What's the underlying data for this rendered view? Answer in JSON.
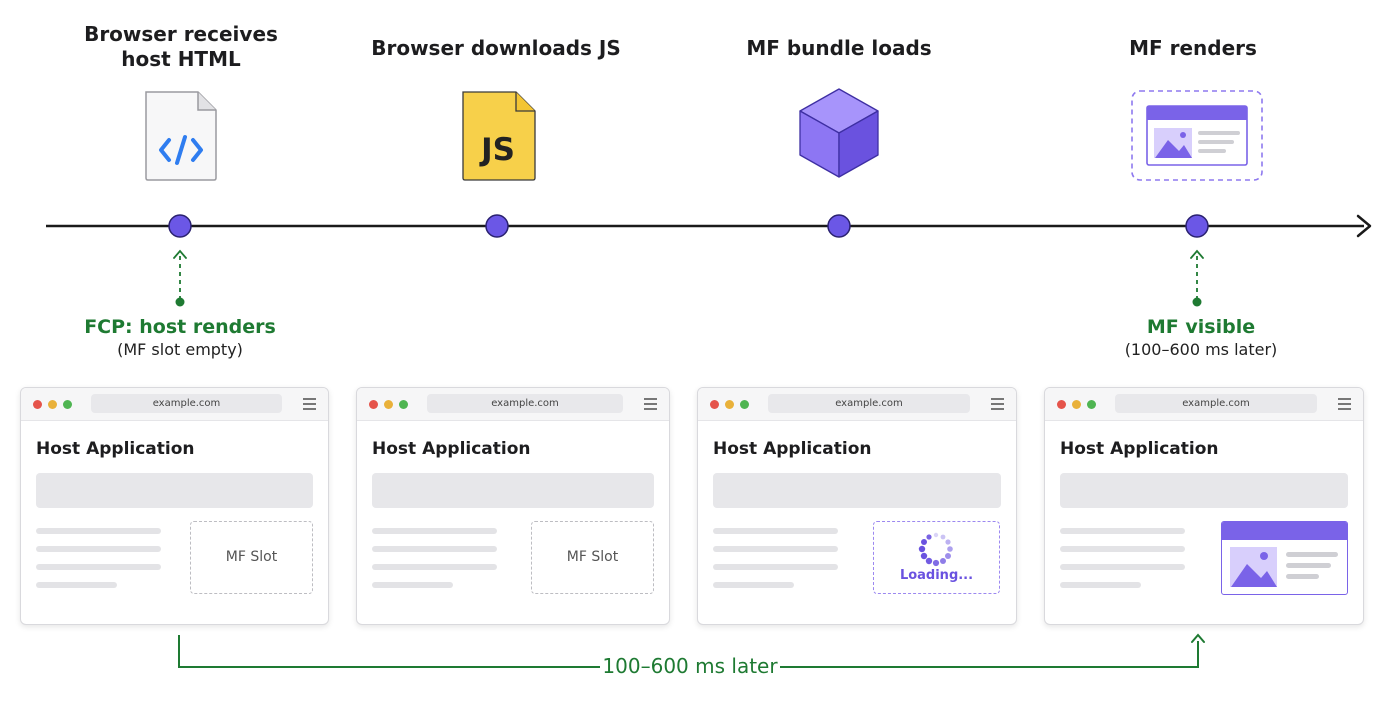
{
  "stages": [
    {
      "title": "Browser receives\nhost HTML",
      "icon": "html-file-icon"
    },
    {
      "title": "Browser downloads JS",
      "icon": "js-file-icon",
      "icon_text": "JS"
    },
    {
      "title": "MF bundle loads",
      "icon": "cube-icon"
    },
    {
      "title": "MF renders",
      "icon": "widget-icon"
    }
  ],
  "notes": {
    "fcp": {
      "title": "FCP: host renders",
      "subtitle": "(MF slot empty)"
    },
    "mf_visible": {
      "title": "MF visible",
      "subtitle": "(100–600 ms later)"
    }
  },
  "browsers": [
    {
      "url": "example.com",
      "app_title": "Host Application",
      "slot_label": "MF Slot"
    },
    {
      "url": "example.com",
      "app_title": "Host Application",
      "slot_label": "MF Slot"
    },
    {
      "url": "example.com",
      "app_title": "Host Application",
      "loading_label": "Loading..."
    },
    {
      "url": "example.com",
      "app_title": "Host Application"
    }
  ],
  "range_label": "100–600 ms later",
  "colors": {
    "accent_purple": "#6b57e6",
    "green": "#1e7a32",
    "js_yellow": "#f7d04a",
    "axis": "#1a1a1a"
  }
}
